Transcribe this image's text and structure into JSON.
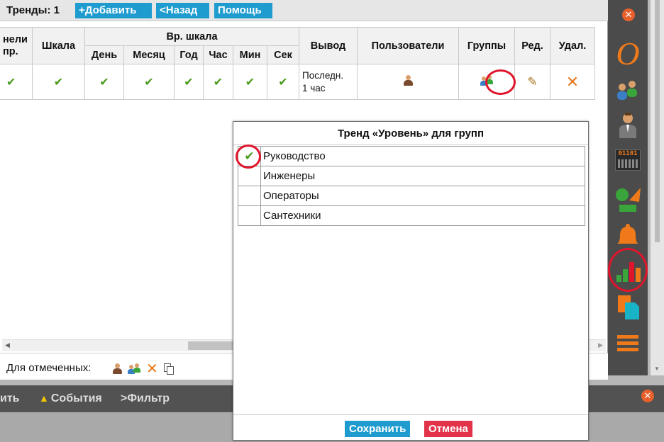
{
  "toolbar": {
    "trends_label": "Тренды: 1",
    "add_label": "+Добавить",
    "back_label": "<Назад",
    "help_label": "Помощь"
  },
  "table": {
    "headers": {
      "panels": "нели пр.",
      "scale": "Шкала",
      "time_scale": "Вр. шкала",
      "day": "День",
      "month": "Месяц",
      "year": "Год",
      "hour": "Час",
      "min": "Мин",
      "sec": "Сек",
      "output": "Вывод",
      "users": "Пользователи",
      "groups": "Группы",
      "edit": "Ред.",
      "delete": "Удал."
    },
    "row": {
      "check": "✔",
      "output_line1": "Последн.",
      "output_line2": "1 час",
      "pencil": "✎",
      "delete": "✕"
    }
  },
  "bulk": {
    "label": "Для отмеченных:"
  },
  "bottom": {
    "print": "ить",
    "events": "События",
    "filter": ">Фильтр",
    "close": "✕"
  },
  "dialog": {
    "title": "Тренд «Уровень» для групп",
    "groups": [
      {
        "name": "Руководство",
        "checked": true,
        "mark": "✔"
      },
      {
        "name": "Инженеры",
        "checked": false,
        "mark": ""
      },
      {
        "name": "Операторы",
        "checked": false,
        "mark": ""
      },
      {
        "name": "Сантехники",
        "checked": false,
        "mark": ""
      }
    ],
    "save_label": "Сохранить",
    "cancel_label": "Отмена"
  },
  "sidebar": {
    "close": "✕",
    "o_logo": "O",
    "binary": "01101"
  },
  "colors": {
    "accent_blue": "#1e9ccf",
    "cancel_red": "#e2334a",
    "check_green": "#4a9a1e",
    "delete_orange": "#e87a1c",
    "highlight_red": "#e0152c",
    "sidebar_bg": "#4b4b4b"
  }
}
